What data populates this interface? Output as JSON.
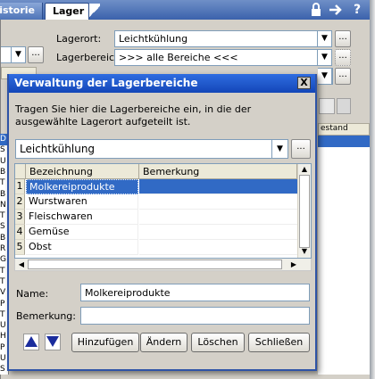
{
  "tabs": {
    "history_label": "Bestellhistorie",
    "lager_label": "Lager"
  },
  "top_icons": [
    "lock-icon",
    "arrow-right-icon",
    "help-icon"
  ],
  "background_form": {
    "lagerort_label": "Lagerort:",
    "lagerort_value": "Leichtkühlung",
    "lagerbereich_label": "Lagerbereich:",
    "lagerbereich_value": ">>> alle Bereiche <<<",
    "dots_label": "...",
    "column_right_partial": "estand",
    "left_list_letters": [
      "D",
      "S",
      "U",
      "B",
      "T",
      "B",
      "N",
      "T",
      "S",
      "B",
      "R",
      "G",
      "T",
      "T",
      "V",
      "P",
      "T",
      "U",
      "H",
      "P",
      "U",
      "S"
    ]
  },
  "dialog": {
    "title": "Verwaltung der Lagerbereiche",
    "close_label": "X",
    "instruction": "Tragen Sie hier die Lagerbereiche ein, in die der ausgewählte Lagerort aufgeteilt ist.",
    "location_value": "Leichtkühlung",
    "dots_label": "...",
    "grid": {
      "columns": [
        "Bezeichnung",
        "Bemerkung"
      ],
      "rows": [
        {
          "num": "1",
          "bezeichnung": "Molkereiprodukte",
          "bemerkung": "",
          "selected": true
        },
        {
          "num": "2",
          "bezeichnung": "Wurstwaren",
          "bemerkung": "",
          "selected": false
        },
        {
          "num": "3",
          "bezeichnung": "Fleischwaren",
          "bemerkung": "",
          "selected": false
        },
        {
          "num": "4",
          "bezeichnung": "Gemüse",
          "bemerkung": "",
          "selected": false
        },
        {
          "num": "5",
          "bezeichnung": "Obst",
          "bemerkung": "",
          "selected": false
        }
      ]
    },
    "name_label": "Name:",
    "name_value": "Molkereiprodukte",
    "bemerkung_label": "Bemerkung:",
    "bemerkung_value": "",
    "buttons": {
      "add": "Hinzufügen",
      "edit": "Ändern",
      "delete": "Löschen",
      "close": "Schließen"
    },
    "colors": {
      "title_bar": "#1f56c9",
      "selection": "#316ac5",
      "arrow_buttons": "#1a2c9c"
    }
  }
}
